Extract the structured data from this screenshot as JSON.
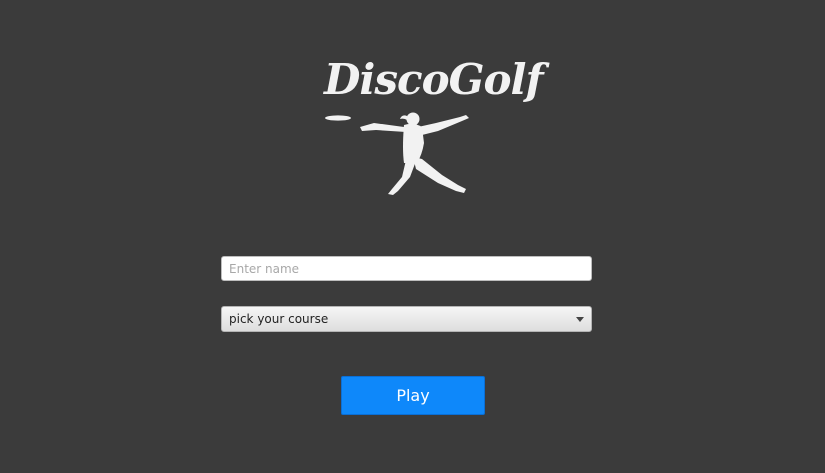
{
  "logo": {
    "title": "DiscoGolf",
    "icon": "disc-thrower-icon"
  },
  "form": {
    "name_placeholder": "Enter name",
    "name_value": "",
    "course_selected": "pick your course",
    "play_label": "Play"
  },
  "colors": {
    "background": "#3b3b3b",
    "logo": "#f2f2f2",
    "play_button": "#0e88fa"
  }
}
